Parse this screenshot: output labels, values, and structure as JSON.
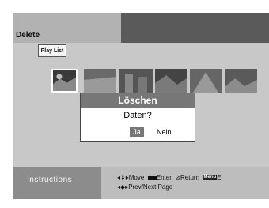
{
  "header": {
    "title": "Delete"
  },
  "tab": {
    "label": "Play List"
  },
  "dialog": {
    "title": "Löschen",
    "message": "Daten?",
    "yes_label": "Ja",
    "no_label": "Nein"
  },
  "instructions": {
    "label": "Instructions",
    "move": "Move",
    "enter": "Enter",
    "return": "Return",
    "menu_key": "Menu",
    "menu_after": "E",
    "prev_next": "Prev/Next Page"
  }
}
